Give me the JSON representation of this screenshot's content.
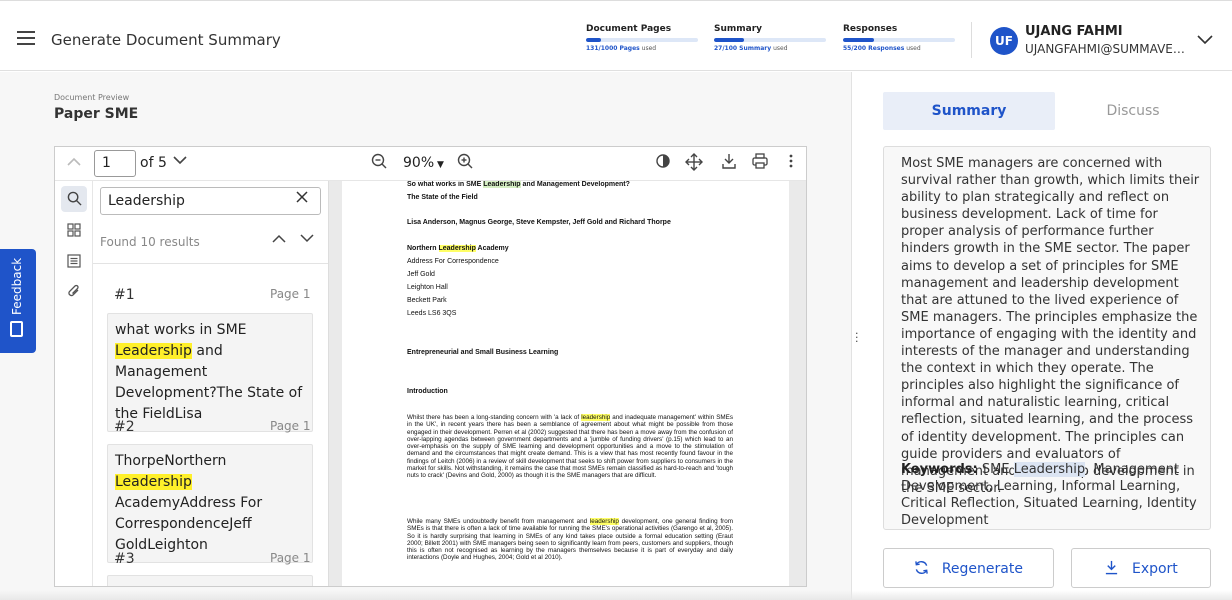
{
  "header": {
    "title": "Generate Document Summary",
    "usage": [
      {
        "label": "Document Pages",
        "count": "131/1000 Pages",
        "suffix": "used",
        "fraction": 0.131
      },
      {
        "label": "Summary",
        "count": "27/100 Summary",
        "suffix": "used",
        "fraction": 0.27
      },
      {
        "label": "Responses",
        "count": "55/200 Responses",
        "suffix": "used",
        "fraction": 0.275
      }
    ],
    "user": {
      "initials": "UF",
      "name": "UJANG FAHMI",
      "email": "UJANGFAHMI@SUMMAVERSE.COM"
    }
  },
  "document": {
    "label": "Document Preview",
    "title": "Paper SME"
  },
  "viewer": {
    "page_value": "1",
    "of_pages": "of 5",
    "zoom": "90%",
    "search_query": "Leadership",
    "found_text": "Found 10 results",
    "results": [
      {
        "num": "#1",
        "page": "Page 1",
        "before": "what works in SME ",
        "match": "Leadership",
        "after": " and Management Development?The State of the FieldLisa"
      },
      {
        "num": "#2",
        "page": "Page 1",
        "before": "ThorpeNorthern ",
        "match": "Leadership",
        "after": " AcademyAddress For CorrespondenceJeff GoldLeighton"
      },
      {
        "num": "#3",
        "page": "Page 1"
      }
    ]
  },
  "paper": {
    "title_a": "So what works in SME ",
    "title_hl": "Leadership",
    "title_b": " and Management Development?",
    "subtitle": "The State of the Field",
    "authors": "Lisa Anderson, Magnus George, Steve Kempster, Jeff Gold and Richard Thorpe",
    "affil_a": "Northern ",
    "affil_hl": "Leadership",
    "affil_b": " Academy",
    "address_lines": [
      "Address For Correspondence",
      "Jeff Gold",
      "Leighton Hall",
      "Beckett Park",
      "Leeds LS6 3QS"
    ],
    "section1": "Entrepreneurial and Small Business Learning",
    "section2": "Introduction",
    "para1_a": "Whilst there has been a long-standing concern with 'a lack of ",
    "para1_hl": "leadership",
    "para1_b": " and inadequate management' within SMEs in the UK', in recent years there has been a semblance of agreement about what might be possible from those engaged in their development. Perren et al (2002) suggested that there has been a move away from the confusion of over-lapping agendas between government departments and a 'jumble of funding drivers' (p.15) which lead to an over-emphasis on the supply of SME learning and development opportunities and a move to the stimulation of demand and the circumstances that might create demand. This is a view that has most recently found favour in the findings of Leitch (2006) in a review of skill development that seeks to shift power from suppliers to consumers in the market for skills. Not withstanding, it remains the case that most SMEs remain classified as hard-to-reach and 'tough nuts to crack' (Devins and Gold, 2000) as though it is the SME managers that are difficult.",
    "para2_a": "While many SMEs undoubtedly benefit from management and ",
    "para2_hl": "leadership",
    "para2_b": " development, one general finding from SMEs is that there is often a lack of time available for running the SME's operational activities (Garengo et al, 2005). So it is hardly surprising that learning in SMEs of any kind takes place outside a formal education setting (Eraut 2000; Billett 2001) with SME managers being seen to significantly learn from peers, customers and suppliers, though this is often not recognised as learning by the managers themselves because it is part of everyday and daily interactions (Doyle and Hughes, 2004; Gold et al 2010)."
  },
  "feedback": {
    "label": "Feedback"
  },
  "right": {
    "tabs": {
      "summary": "Summary",
      "discuss": "Discuss"
    },
    "summary_text": "Most SME managers are concerned with survival rather than growth, which limits their ability to plan strategically and reflect on business development. Lack of time for proper analysis of performance further hinders growth in the SME sector. The paper aims to develop a set of principles for SME management and leadership development that are attuned to the lived experience of SME managers. The principles emphasize the importance of engaging with the identity and interests of the manager and understanding the context in which they operate. The principles also highlight the significance of informal and naturalistic learning, critical reflection, situated learning, and the process of identity development. The principles can guide providers and evaluators of management and leadership development in the SME sector.",
    "keywords_label": "Keywords:",
    "keywords_a": " SME ",
    "keywords_hl": "Leadership",
    "keywords_b": ", Management Development, Learning, Informal Learning, Critical Reflection, Situated Learning, Identity Development",
    "regenerate": "Regenerate",
    "export": "Export"
  },
  "colors": {
    "accent": "#1f54c9",
    "highlight": "#fff02a"
  }
}
